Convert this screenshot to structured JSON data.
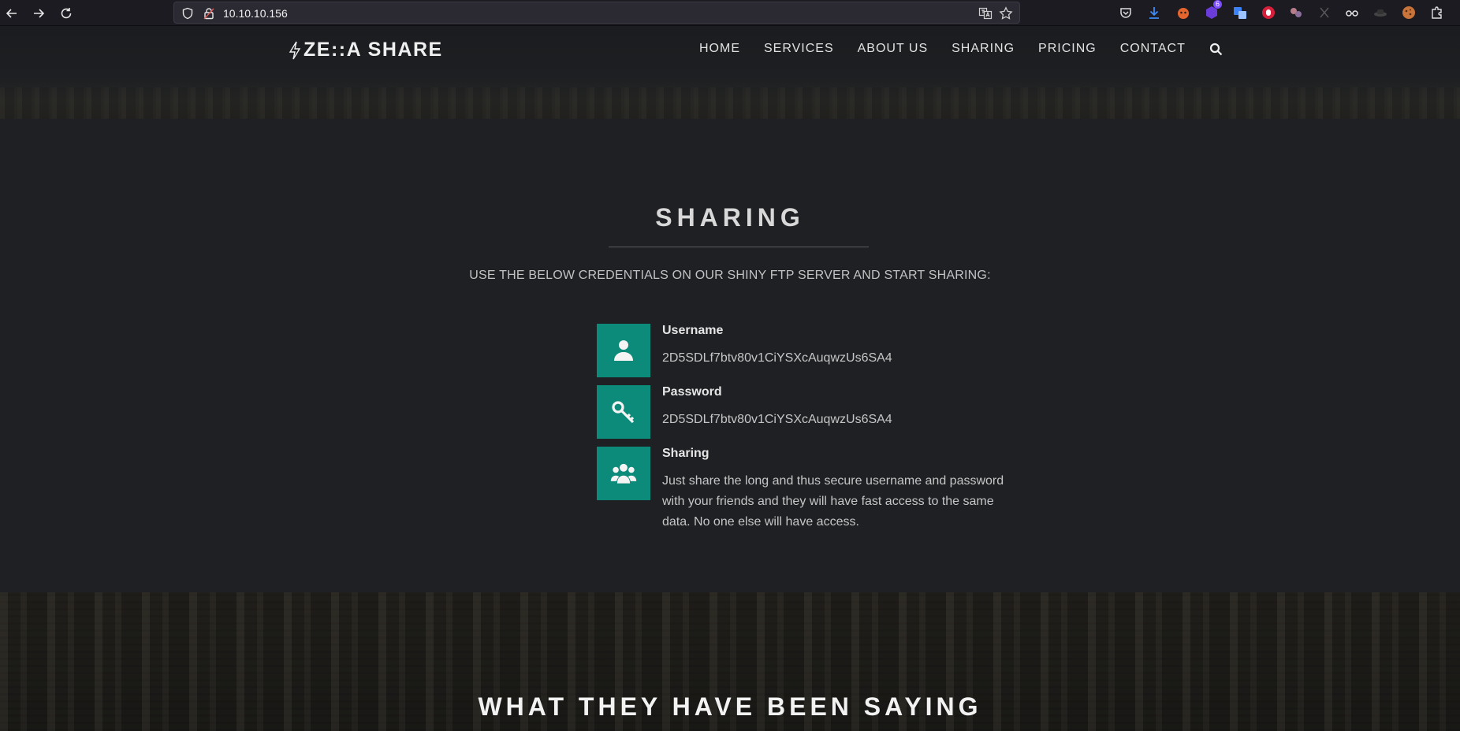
{
  "browser": {
    "url": "10.10.10.156",
    "ext_badge": "6"
  },
  "site": {
    "logo": "ZE::A SHARE",
    "nav": [
      "HOME",
      "SERVICES",
      "ABOUT US",
      "SHARING",
      "PRICING",
      "CONTACT"
    ]
  },
  "sharing": {
    "title": "SHARING",
    "subtitle": "USE THE BELOW CREDENTIALS ON OUR SHINY FTP SERVER AND START SHARING:",
    "items": [
      {
        "label": "Username",
        "value": "2D5SDLf7btv80v1CiYSXcAuqwzUs6SA4",
        "icon": "user-icon"
      },
      {
        "label": "Password",
        "value": "2D5SDLf7btv80v1CiYSXcAuqwzUs6SA4",
        "icon": "key-icon"
      },
      {
        "label": "Sharing",
        "value": "Just share the long and thus secure username and password with your friends and they will have fast access to the same data. No one else will have access.",
        "icon": "users-icon"
      }
    ]
  },
  "testimonials": {
    "title": "WHAT THEY HAVE BEEN SAYING"
  },
  "colors": {
    "accent": "#0d8b7a",
    "background": "#1e2023"
  }
}
